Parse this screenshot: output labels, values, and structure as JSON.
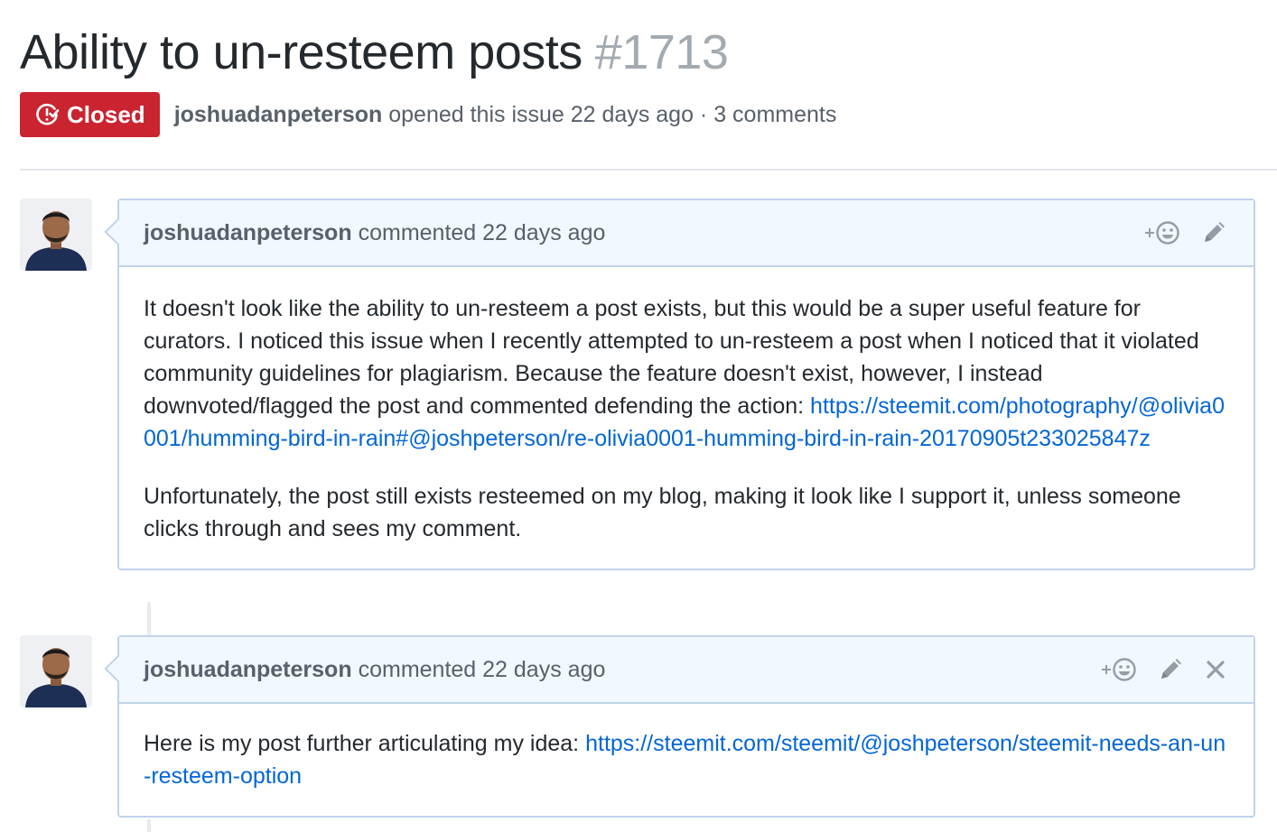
{
  "issue": {
    "title": "Ability to un-resteem posts",
    "number": "#1713",
    "state": "Closed",
    "author": "joshuadanpeterson",
    "meta": "opened this issue 22 days ago · 3 comments"
  },
  "comments": [
    {
      "author": "joshuadanpeterson",
      "meta": "commented 22 days ago",
      "actions": [
        "add-reaction-icon",
        "pencil-icon"
      ],
      "paragraph1": "It doesn't look like the ability to un-resteem a post exists, but this would be a super useful feature for curators. I noticed this issue when I recently attempted to un-resteem a post when I noticed that it violated community guidelines for plagiarism. Because the feature doesn't exist, however, I instead downvoted/flagged the post and commented defending the action:",
      "link1": "https://steemit.com/photography/@olivia0001/humming-bird-in-rain#@joshpeterson/re-olivia0001-humming-bird-in-rain-20170905t233025847z",
      "paragraph2": "Unfortunately, the post still exists resteemed on my blog, making it look like I support it, unless someone clicks through and sees my comment."
    },
    {
      "author": "joshuadanpeterson",
      "meta": "commented 22 days ago",
      "actions": [
        "add-reaction-icon",
        "pencil-icon",
        "close-icon"
      ],
      "text": "Here is my post further articulating my idea:",
      "link": "https://steemit.com/steemit/@joshpeterson/steemit-needs-an-un-resteem-option"
    }
  ],
  "colors": {
    "closed_badge": "#cb2431",
    "link": "#0366d6",
    "comment_header_bg": "#f1f8ff",
    "comment_border": "#c0d3eb"
  }
}
